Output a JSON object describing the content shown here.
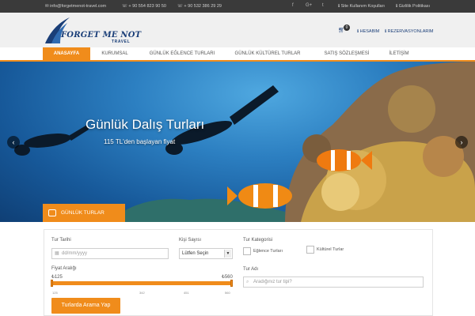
{
  "topbar": {
    "email": "info@forgetmenot-travel.com",
    "phone1": "+ 90 554 823 90 50",
    "phone2": "+ 90 532 386 29 29",
    "social": [
      {
        "icon": "facebook-icon",
        "glyph": "f"
      },
      {
        "icon": "googleplus-icon",
        "glyph": "G+"
      },
      {
        "icon": "twitter-icon",
        "glyph": "t"
      }
    ],
    "terms": "Site Kullanım Koşulları",
    "privacy": "Gizlilik Politikası"
  },
  "header": {
    "brand": "FORGET ME NOT",
    "brand_sub": "TRAVEL",
    "cart_count": "0",
    "account": "HESABIM",
    "reservations": "REZERVASYONLARIM"
  },
  "nav": {
    "items": [
      {
        "label": "ANASAYFA",
        "active": true
      },
      {
        "label": "KURUMSAL",
        "active": false
      },
      {
        "label": "GÜNLÜK EĞLENCE TURLARI",
        "active": false
      },
      {
        "label": "GÜNLÜK KÜLTÜREL TURLAR",
        "active": false
      },
      {
        "label": "SATIŞ SÖZLEŞMESİ",
        "active": false
      },
      {
        "label": "İLETİŞİM",
        "active": false
      }
    ]
  },
  "hero": {
    "title": "Günlük Dalış Turları",
    "subtitle": "115 TL'den başlayan fiyat",
    "badge": "GÜNLÜK TURLAR"
  },
  "search": {
    "date_label": "Tur Tarihi",
    "date_placeholder": "dd/mm/yyyy",
    "persons_label": "Kişi Sayısı",
    "persons_value": "Lütfen Seçin",
    "category_label": "Tur Kategorisi",
    "cat_fun": "Eğlence Turları",
    "cat_culture": "Kültürel Turlar",
    "price_label": "Fiyat Aralığı",
    "price_min": "₺125",
    "price_max": "₺560",
    "ticks": [
      "125",
      "342",
      "451",
      "560"
    ],
    "tour_name_label": "Tur Adı",
    "tour_name_placeholder": "Aradığınız tur tipi?",
    "submit": "Turlarda Arama Yap"
  },
  "colors": {
    "accent": "#f08c1b",
    "brand": "#1a3e78",
    "topbar": "#3a3a3a"
  }
}
